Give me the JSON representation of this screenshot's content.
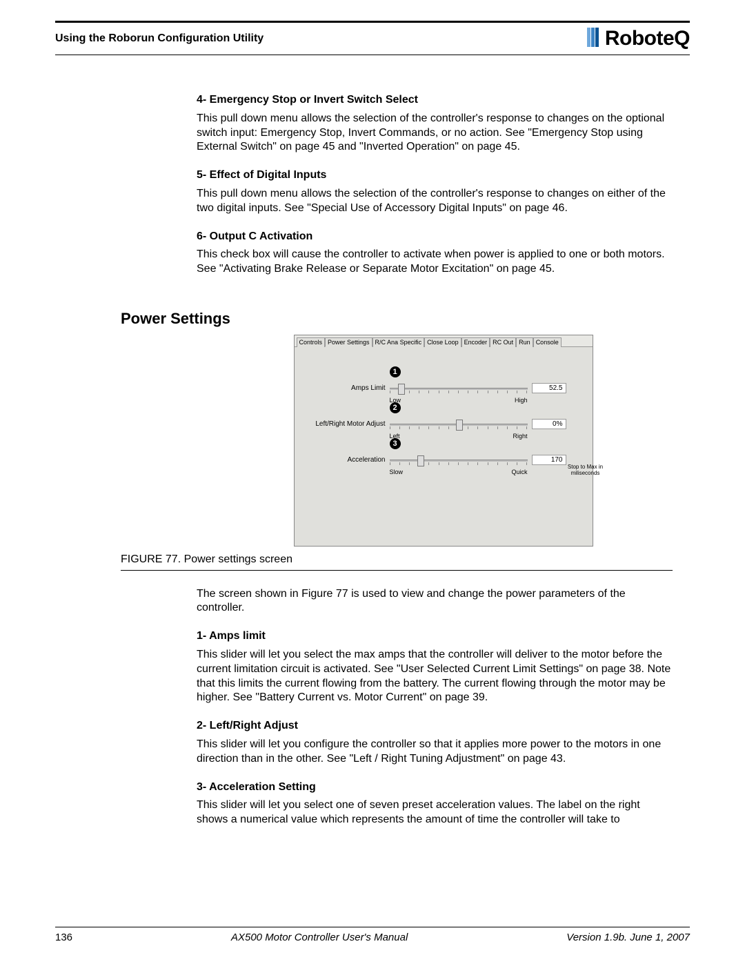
{
  "header": {
    "section_title": "Using the Roborun Configuration Utility",
    "brand": "RoboteQ"
  },
  "sections": [
    {
      "heading": "4- Emergency Stop or Invert Switch Select",
      "body": "This pull down menu allows the selection of the controller's response to changes on the optional switch input: Emergency Stop, Invert Commands, or no action. See \"Emergency Stop using External Switch\" on page 45 and \"Inverted Operation\" on page 45."
    },
    {
      "heading": "5- Effect of Digital Inputs",
      "body": "This pull down menu allows the selection of the controller's response to changes on either of the two digital inputs. See \"Special Use of Accessory Digital Inputs\" on page 46."
    },
    {
      "heading": "6- Output C Activation",
      "body": "This check box will cause the controller to activate when power is applied to one or both motors. See \"Activating Brake Release or Separate Motor Excitation\" on page 45."
    }
  ],
  "section_title_big": "Power Settings",
  "screenshot": {
    "tabs": [
      "Controls",
      "Power Settings",
      "R/C Ana Specific",
      "Close Loop",
      "Encoder",
      "RC Out",
      "Run",
      "Console"
    ],
    "rows": [
      {
        "num": "1",
        "label": "Amps Limit",
        "left_end": "Low",
        "right_end": "High",
        "value": "52.5",
        "thumb_pct": 6,
        "sub": ""
      },
      {
        "num": "2",
        "label": "Left/Right Motor Adjust",
        "left_end": "Left",
        "right_end": "Right",
        "value": "0%",
        "thumb_pct": 48,
        "sub": ""
      },
      {
        "num": "3",
        "label": "Acceleration",
        "left_end": "Slow",
        "right_end": "Quick",
        "value": "170",
        "thumb_pct": 20,
        "sub": "Stop to Max in miliseconds"
      }
    ]
  },
  "figure_caption": "FIGURE 77. Power settings screen",
  "post_fig_para": "The screen shown in Figure 77 is used to view and change the power parameters of the controller.",
  "post_sections": [
    {
      "heading": "1- Amps limit",
      "body": "This slider will let you select the max amps that the controller will deliver to the motor before the current limitation circuit is activated. See \"User Selected Current Limit Settings\" on page 38. Note that this limits the current flowing from the battery. The current flowing through the motor may be higher. See \"Battery Current vs. Motor Current\" on page 39."
    },
    {
      "heading": "2- Left/Right Adjust",
      "body": "This slider will let you configure the controller so that it applies more power to the motors in one direction than in the other. See \"Left / Right Tuning Adjustment\" on page 43."
    },
    {
      "heading": "3- Acceleration Setting",
      "body": "This slider will let you select one of seven preset acceleration values. The label on the right shows a numerical value which represents the amount of time the controller will take to"
    }
  ],
  "footer": {
    "page": "136",
    "center": "AX500 Motor Controller User's Manual",
    "right": "Version 1.9b. June 1, 2007"
  }
}
